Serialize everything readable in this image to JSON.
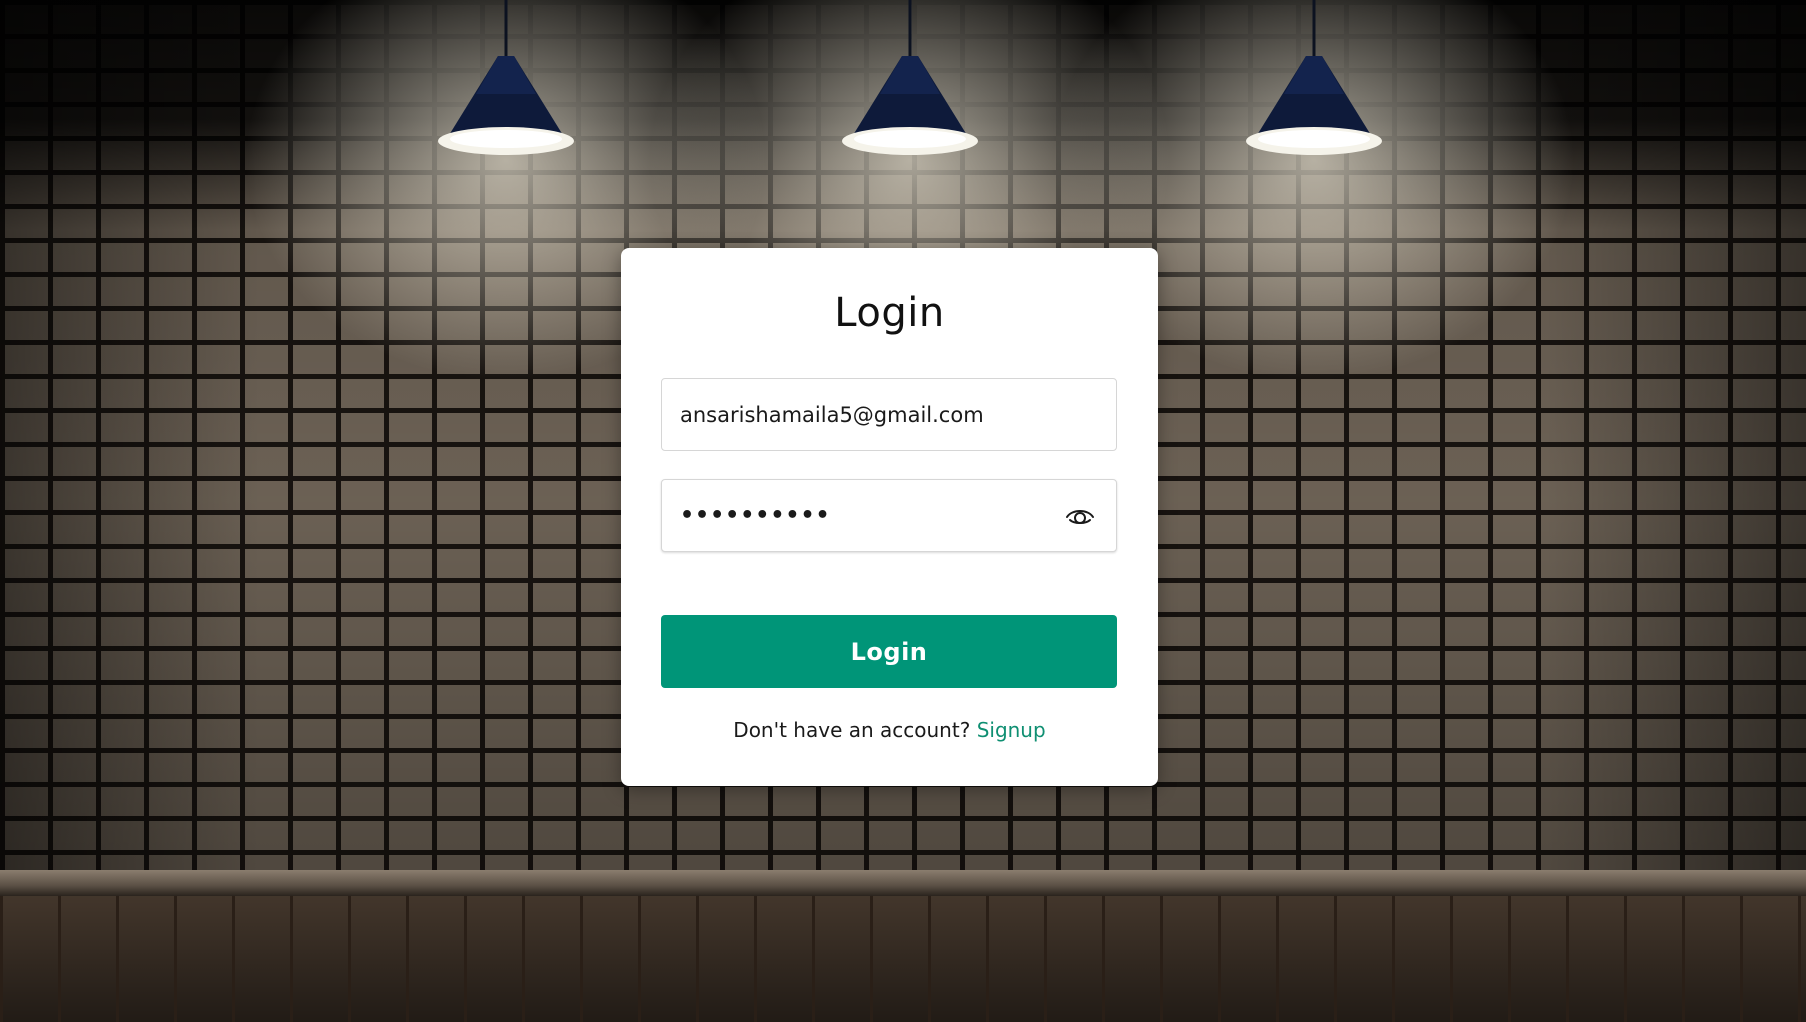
{
  "login": {
    "title": "Login",
    "email_value": "ansarishamaila5@gmail.com",
    "password_masked": "••••••••••",
    "submit_label": "Login",
    "signup_prompt": "Don't have an account?",
    "signup_link": "Signup"
  },
  "icons": {
    "password_toggle": "eye-icon"
  },
  "colors": {
    "accent": "#009578",
    "link": "#0f8f72",
    "card_bg": "#ffffff"
  }
}
